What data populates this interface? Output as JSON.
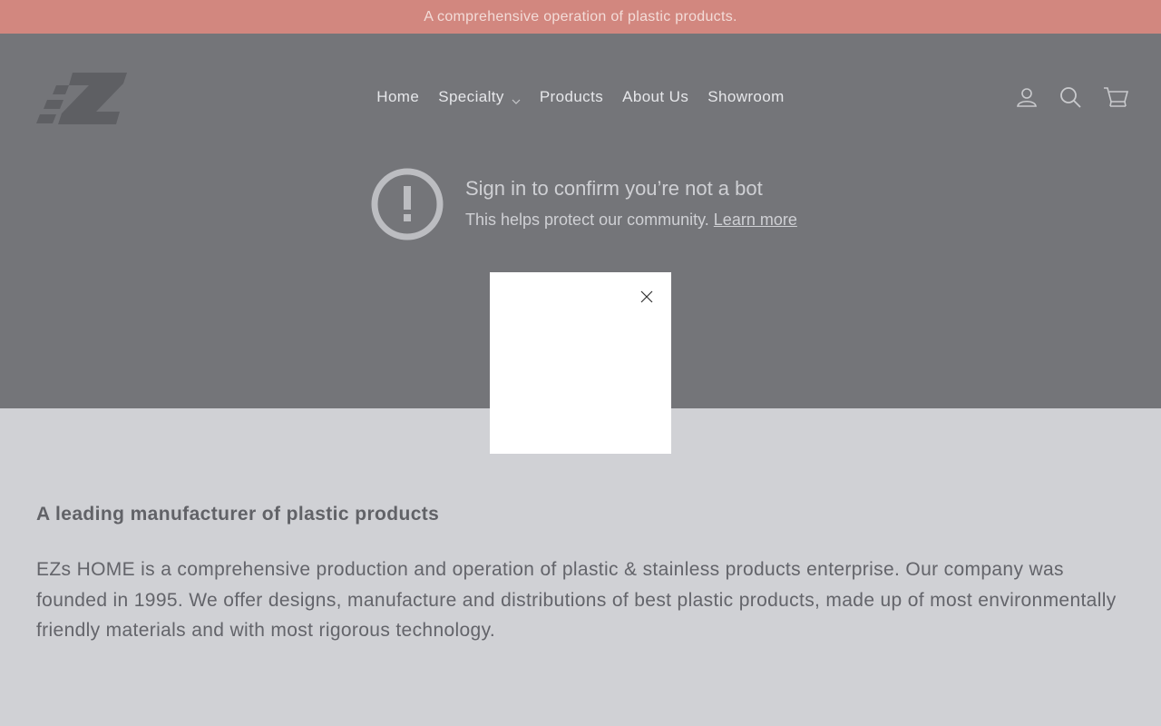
{
  "announcement": "A comprehensive operation of plastic products.",
  "colors": {
    "announcement_bg": "#d2877f",
    "hero_bg": "#747579",
    "body_bg": "#d0d1d5"
  },
  "nav": {
    "items": [
      {
        "label": "Home"
      },
      {
        "label": "Specialty",
        "has_dropdown": true
      },
      {
        "label": "Products"
      },
      {
        "label": "About Us"
      },
      {
        "label": "Showroom"
      }
    ]
  },
  "header_icons": [
    "account-icon",
    "search-icon",
    "cart-icon"
  ],
  "bot_notice": {
    "title": "Sign in to confirm you’re not a bot",
    "subtitle": "This helps protect our community.",
    "link": "Learn more"
  },
  "content": {
    "heading": "A leading manufacturer of plastic products",
    "body": "EZs HOME is a comprehensive production and operation of plastic & stainless products enterprise. Our company was founded in 1995. We offer designs, manufacture and distributions of best plastic products, made up of most environmentally friendly materials and with most rigorous technology."
  }
}
